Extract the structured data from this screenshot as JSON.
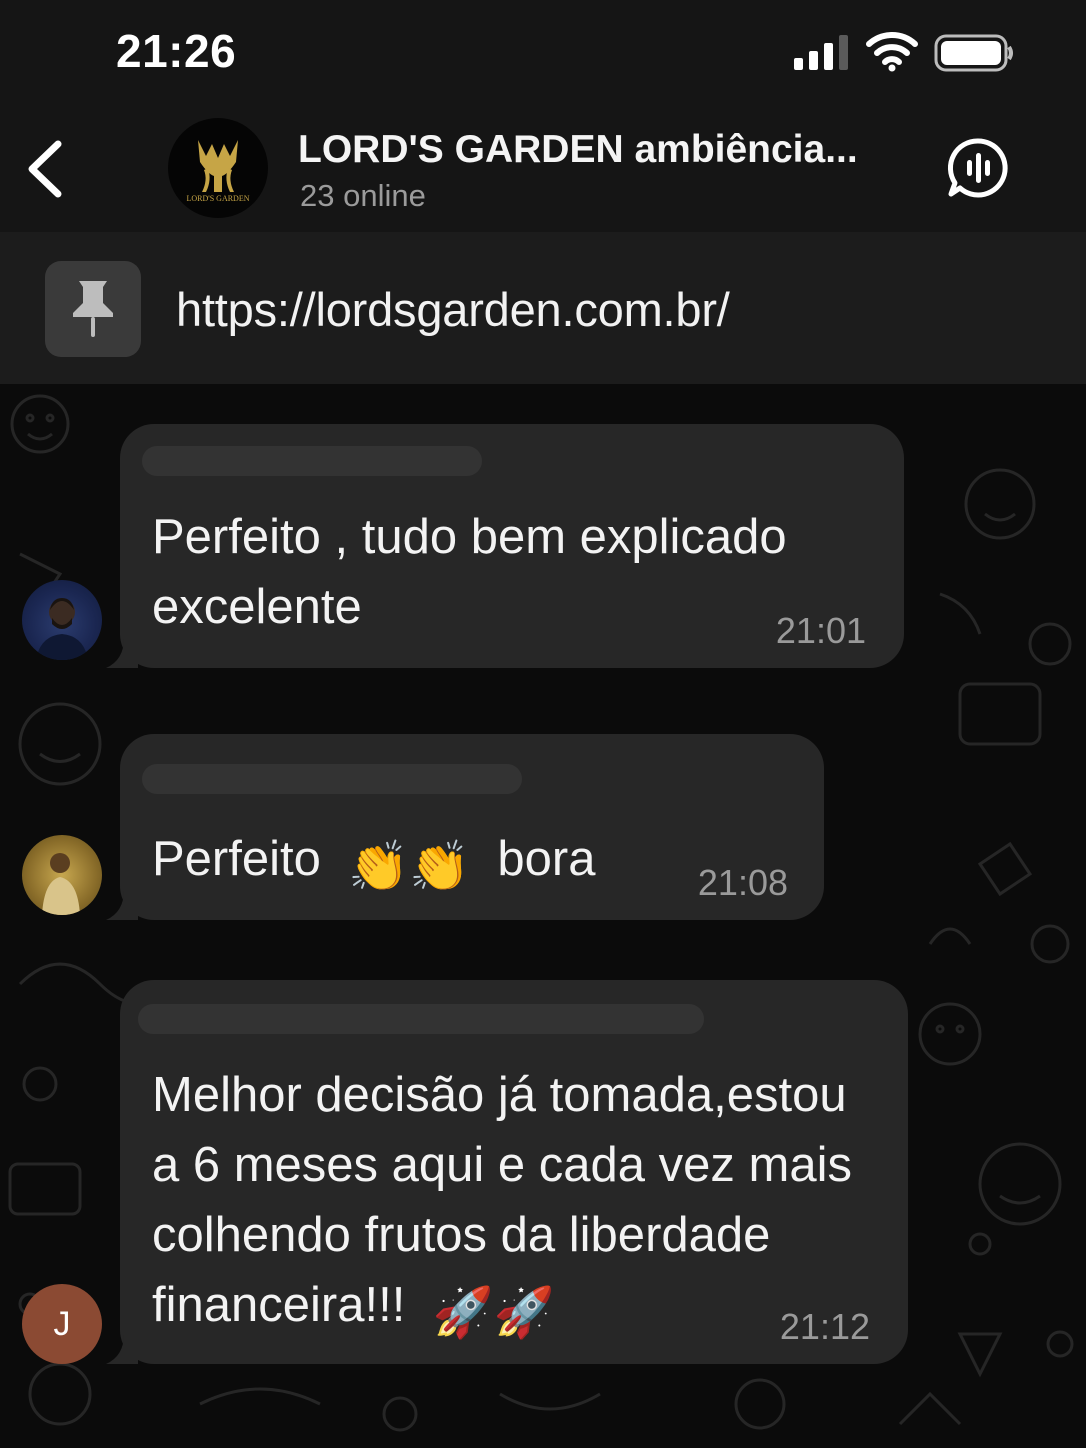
{
  "status_bar": {
    "time": "21:26"
  },
  "header": {
    "title": "LORD'S GARDEN ambiência...",
    "subtitle": "23 online",
    "avatar_logo_text": "LORD'S GARDEN"
  },
  "pinned": {
    "link": "https://lordsgarden.com.br/"
  },
  "messages": [
    {
      "text_lines": [
        "Perfeito , tudo bem explicado",
        "excelente"
      ],
      "time": "21:01"
    },
    {
      "text_before": "Perfeito",
      "emoji": "👏👏",
      "text_after": "bora",
      "time": "21:08"
    },
    {
      "text_lines": [
        "Melhor decisão já tomada,estou",
        "a 6 meses aqui e cada vez mais",
        "colhendo frutos da liberdade"
      ],
      "last_line_text": "financeira!!!",
      "last_line_emoji": "🚀🚀",
      "time": "21:12",
      "avatar_initial": "J"
    }
  ],
  "colors": {
    "background": "#0b0b0b",
    "header": "#151515",
    "pinned_bar": "#1c1c1c",
    "bubble": "#272727",
    "avatar_initial_bg": "#8b4a33",
    "logo_gold": "#c6a546"
  }
}
